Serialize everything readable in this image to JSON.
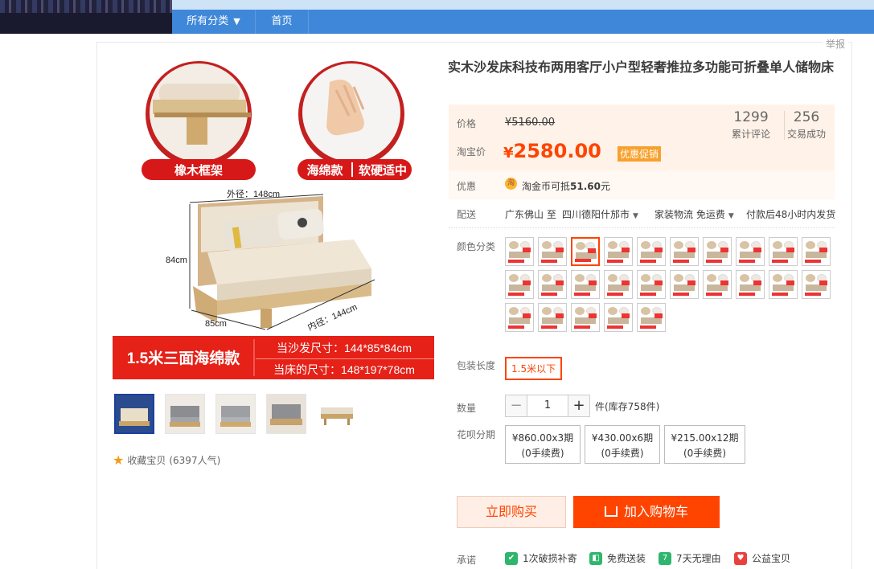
{
  "nav": {
    "all_categories": "所有分类",
    "home": "首页"
  },
  "report_label": "举报",
  "product": {
    "title": "实木沙发床科技布两用客厅小户型轻奢推拉多功能可折叠单人储物床"
  },
  "image_labels": {
    "frame": "橡木框架",
    "sponge": "海绵款",
    "firmness": "软硬适中",
    "outer_diameter": "外径：148cm",
    "height": "84cm",
    "depth": "85cm",
    "inner_diameter": "内径：144cm",
    "banner_main": "1.5米三面海绵款",
    "sofa_size": "当沙发尺寸：144*85*84cm",
    "bed_size": "当床的尺寸：148*197*78cm"
  },
  "favorite": {
    "text": "收藏宝贝",
    "count": "(6397人气)"
  },
  "price": {
    "original_label": "价格",
    "original_value": "¥5160.00",
    "taobao_label": "淘宝价",
    "currency": "¥",
    "taobao_value": "2580.00",
    "promo_badge": "优惠促销",
    "reviews_count": "1299",
    "reviews_label": "累计评论",
    "deals_count": "256",
    "deals_label": "交易成功"
  },
  "coupon": {
    "label": "优惠",
    "coin_icon_text": "淘",
    "text_prefix": "淘金币可抵",
    "amount": "51.60",
    "text_suffix": "元"
  },
  "shipping": {
    "label": "配送",
    "from": "广东佛山",
    "to_word": "至",
    "destination": "四川德阳什邡市",
    "method": "家装物流 免运费",
    "ship_time": "付款后48小时内发货"
  },
  "color": {
    "label": "颜色分类",
    "swatch_count": 25,
    "selected_index": 2
  },
  "package": {
    "label": "包装长度",
    "value": "1.5米以下"
  },
  "quantity": {
    "label": "数量",
    "minus": "−",
    "value": "1",
    "plus": "+",
    "stock": "件(库存758件)"
  },
  "installment": {
    "label": "花呗分期",
    "options": [
      {
        "price": "¥860.00x3期",
        "fee": "(0手续费)"
      },
      {
        "price": "¥430.00x6期",
        "fee": "(0手续费)"
      },
      {
        "price": "¥215.00x12期",
        "fee": "(0手续费)"
      }
    ]
  },
  "actions": {
    "buy_now": "立即购买",
    "add_to_cart": "加入购物车"
  },
  "promise": {
    "label": "承诺",
    "items": [
      "1次破损补寄",
      "免费送装",
      "7天无理由",
      "公益宝贝"
    ]
  },
  "colors": {
    "accent": "#ff4400",
    "nav_blue": "#3f88d9",
    "price_bg": "#fff2e8",
    "promo_badge": "#f7a12d"
  }
}
